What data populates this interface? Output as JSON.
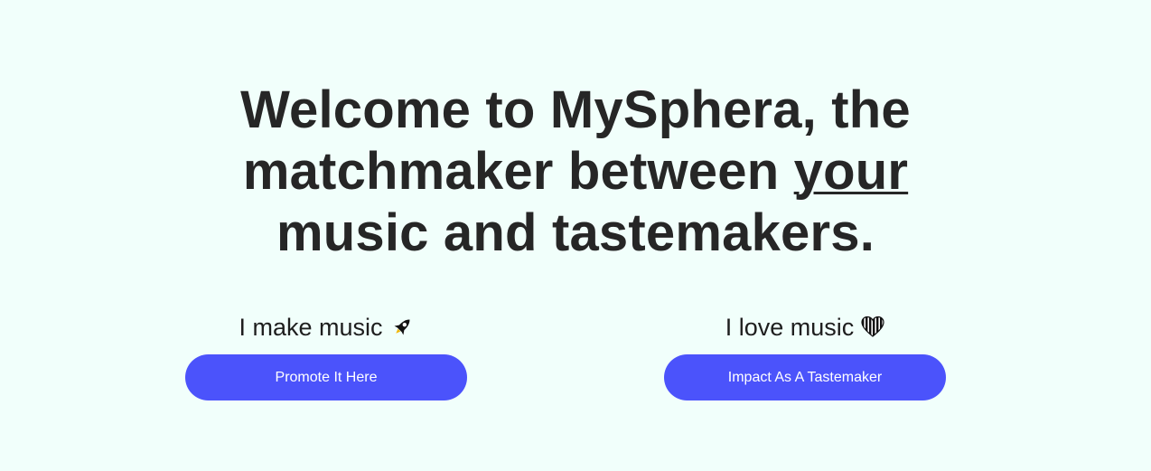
{
  "hero": {
    "line1": "Welcome to MySphera, the",
    "line2_before": "matchmaker between ",
    "line2_emph": "your",
    "line3": "music and tastemakers."
  },
  "artist": {
    "heading": "I make music",
    "icon": "rocket-icon",
    "button_label": "Promote It Here"
  },
  "curator": {
    "heading": "I love music",
    "icon": "heart-icon",
    "button_label": "Impact As A Tastemaker"
  },
  "colors": {
    "background": "#f1fffb",
    "accent": "#4b53fb",
    "text": "#262626"
  }
}
